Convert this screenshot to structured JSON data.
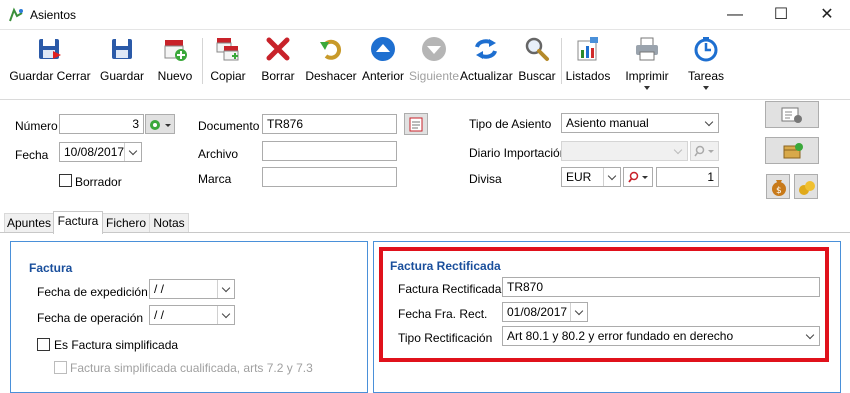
{
  "window": {
    "title": "Asientos",
    "minimize": "—",
    "maximize": "☐",
    "close": "✕"
  },
  "toolbar": {
    "items": [
      {
        "label": "Guardar Cerrar",
        "icon": "save-close-icon",
        "enabled": true
      },
      {
        "label": "Guardar",
        "icon": "save-icon",
        "enabled": true
      },
      {
        "label": "Nuevo",
        "icon": "new-icon",
        "enabled": true
      },
      {
        "label": "Copiar",
        "icon": "copy-icon",
        "enabled": true
      },
      {
        "label": "Borrar",
        "icon": "delete-icon",
        "enabled": true
      },
      {
        "label": "Deshacer",
        "icon": "undo-icon",
        "enabled": true
      },
      {
        "label": "Anterior",
        "icon": "arrow-up-icon",
        "enabled": true
      },
      {
        "label": "Siguiente",
        "icon": "arrow-down-icon",
        "enabled": false
      },
      {
        "label": "Actualizar",
        "icon": "refresh-icon",
        "enabled": true
      },
      {
        "label": "Buscar",
        "icon": "search-icon",
        "enabled": true
      },
      {
        "label": "Listados",
        "icon": "report-icon",
        "enabled": true
      },
      {
        "label": "Imprimir",
        "icon": "printer-icon",
        "enabled": true
      },
      {
        "label": "Tareas",
        "icon": "tasks-icon",
        "enabled": true
      }
    ]
  },
  "header": {
    "numero_label": "Número",
    "numero_value": "3",
    "fecha_label": "Fecha",
    "fecha_value": "10/08/2017",
    "borrador_label": "Borrador",
    "borrador_checked": false,
    "documento_label": "Documento",
    "documento_value": "TR876",
    "archivo_label": "Archivo",
    "archivo_value": "",
    "marca_label": "Marca",
    "marca_value": "",
    "tipo_asiento_label": "Tipo de Asiento",
    "tipo_asiento_value": "Asiento manual",
    "diario_label": "Diario Importación",
    "diario_value": "",
    "divisa_label": "Divisa",
    "divisa_value": "EUR",
    "cambio_value": "1"
  },
  "tabs": [
    {
      "label": "Apuntes",
      "active": false
    },
    {
      "label": "Factura",
      "active": true
    },
    {
      "label": "Fichero",
      "active": false
    },
    {
      "label": "Notas",
      "active": false
    }
  ],
  "factura": {
    "title": "Factura",
    "expedicion_label": "Fecha de expedición",
    "expedicion_value": " / /",
    "operacion_label": "Fecha de operación",
    "operacion_value": " / /",
    "simplificada_label": "Es Factura simplificada",
    "simplificada_checked": false,
    "cualificada_label": "Factura simplificada cualificada, arts 7.2 y 7.3",
    "cualificada_checked": false
  },
  "rectificada": {
    "title": "Factura Rectificada",
    "factura_label": "Factura Rectificada",
    "factura_value": "TR870",
    "fecha_label": "Fecha Fra. Rect.",
    "fecha_value": "01/08/2017",
    "tipo_label": "Tipo Rectificación",
    "tipo_value": "Art 80.1 y 80.2 y error fundado en derecho"
  },
  "colors": {
    "highlight": "#e0111b",
    "panel_border": "#4a90d9",
    "panel_title": "#1a4f9c"
  }
}
